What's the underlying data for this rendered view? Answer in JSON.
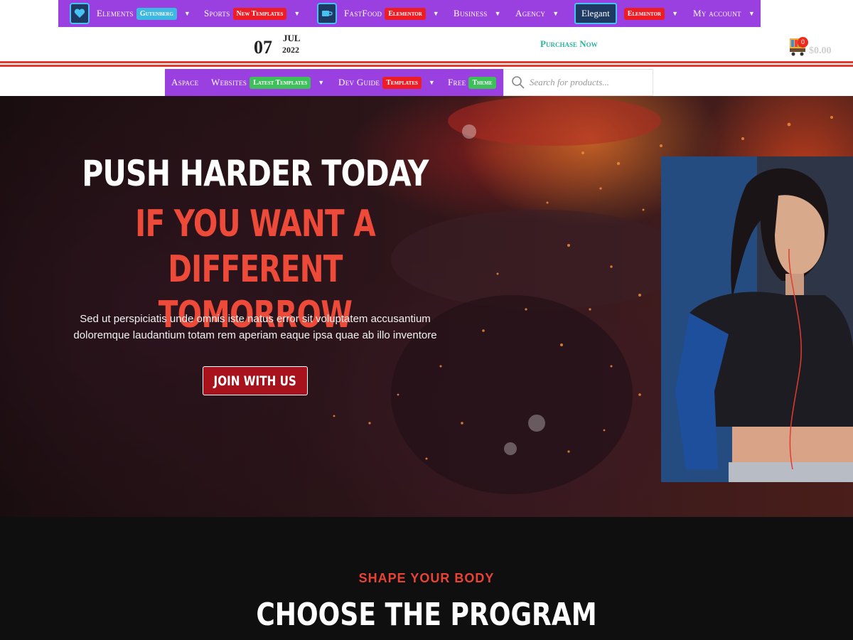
{
  "topnav": {
    "items": [
      {
        "label": "Elements",
        "badge": "Gutenberg",
        "badge_color": "#3db8e0",
        "icon": "heart-icon"
      },
      {
        "label": "Sports",
        "badge": "New Templates",
        "badge_color": "#ee1c24"
      },
      {
        "label": "FastFood",
        "badge": "Elementor",
        "badge_color": "#ee1c24",
        "icon": "coffee-cup-icon"
      },
      {
        "label": "Business"
      },
      {
        "label": "Agency"
      },
      {
        "label": "Elegant",
        "badge": "Elementor",
        "badge_color": "#ee1c24"
      },
      {
        "label": "My account"
      }
    ],
    "background": "#9a3fe0"
  },
  "date": {
    "day": "07",
    "month": "JUL",
    "year": "2022"
  },
  "purchase_label": "Purchase Now",
  "cart": {
    "count": "0",
    "total": "$0.00",
    "icon": "cart-icon"
  },
  "subnav": {
    "items": [
      {
        "label": "Aspace"
      },
      {
        "label": "Websites",
        "badge": "Latest Templates",
        "badge_color": "#3dbf5a"
      },
      {
        "label": "Dev Guide",
        "badge": "Templates",
        "badge_color": "#ee1c24"
      },
      {
        "label": "Free",
        "badge": "Theme",
        "badge_color": "#3dbf5a"
      }
    ]
  },
  "search": {
    "placeholder": "Search for products...",
    "icon": "search-icon"
  },
  "hero": {
    "title_line1": "PUSH HARDER TODAY",
    "title_line2": "IF YOU WANT A DIFFERENT",
    "title_line3": "TOMORROW",
    "description_line1": "Sed ut perspiciatis unde omnis iste natus error sit voluptatem accusantium",
    "description_line2": "doloremque laudantium totam rem aperiam eaque ipsa quae ab illo inventore",
    "button_label": "JOIN WITH US",
    "accent": "#ee4a3a"
  },
  "section": {
    "subtitle": "SHAPE YOUR BODY",
    "title": "CHOOSE THE PROGRAM"
  }
}
